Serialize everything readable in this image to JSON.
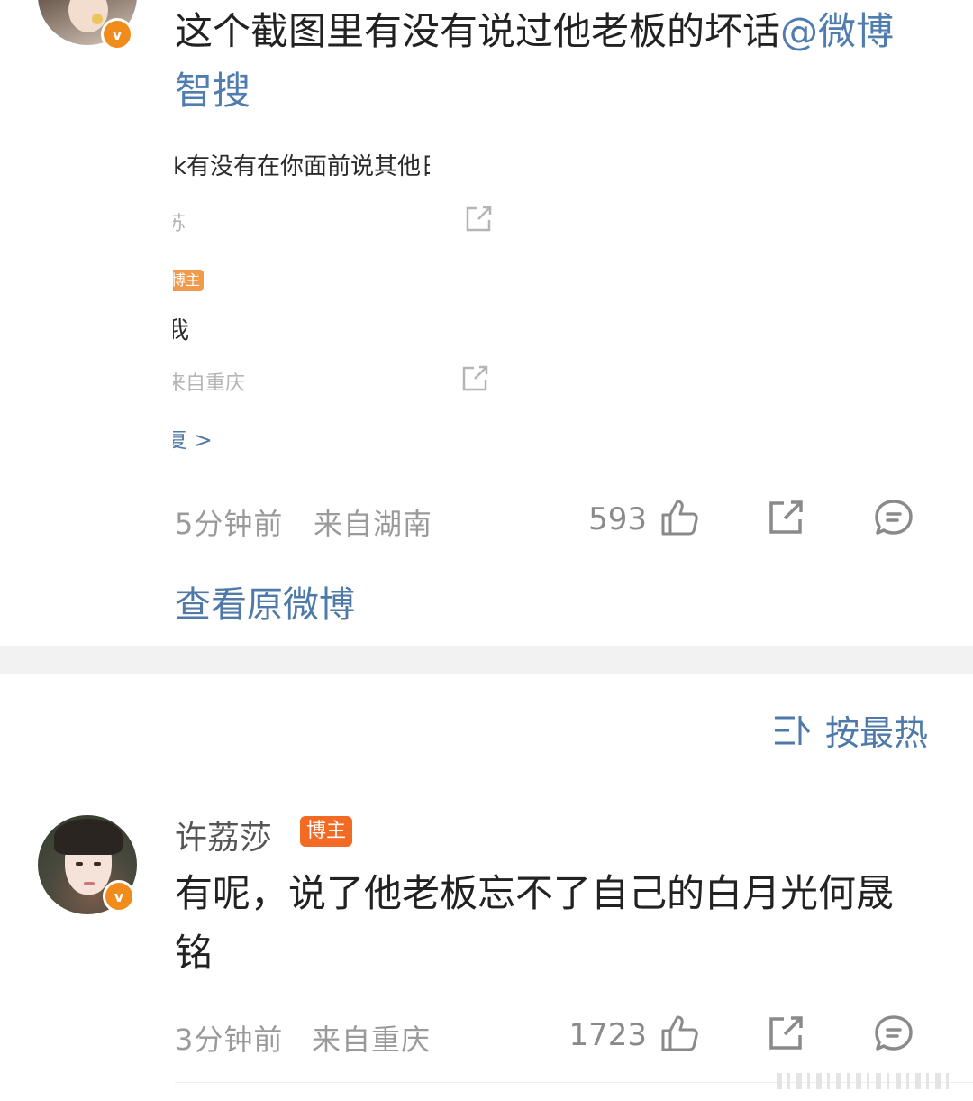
{
  "comment1": {
    "text_prefix": "这个截图里有没有说过他老板的坏话",
    "mention": "@微博智搜",
    "time": "5分钟前",
    "location": "来自湖南",
    "likes": "593"
  },
  "embedded_screenshot": {
    "line1": "k有没有在你面前说其他",
    "line1_tail": "日",
    "loc1": "苏",
    "badge": "博主",
    "name_frag": "我",
    "loc2": "来自重庆",
    "more": "复 >"
  },
  "view_original": "查看原微博",
  "sort": {
    "label": "按最热"
  },
  "comment2": {
    "author": "许荔莎",
    "badge": "博主",
    "text": "有呢，说了他老板忘不了自己的白月光何晟铭",
    "time": "3分钟前",
    "location": "来自重庆",
    "likes": "1723"
  },
  "colors": {
    "link": "#4e79a8",
    "verified_badge": "#f08c1b",
    "blogger_badge": "#f26a24"
  },
  "icons": {
    "like": "thumbs-up-icon",
    "share": "share-icon",
    "comment": "comment-icon",
    "sort": "sort-icon",
    "verified": "verified-v-icon"
  }
}
